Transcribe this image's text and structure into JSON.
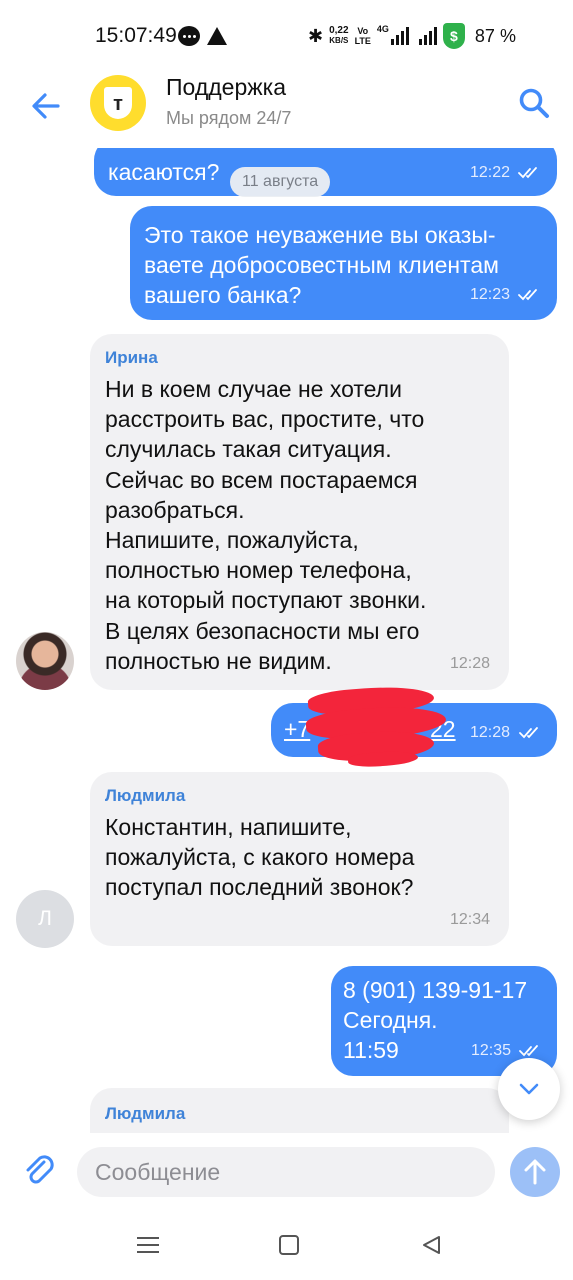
{
  "status_bar": {
    "time": "15:07:49",
    "speed_value": "0,22",
    "speed_unit": "KB/S",
    "volte_top": "Vo",
    "volte_bottom": "LTE",
    "network": "4G",
    "shield_symbol": "$",
    "battery": "87 %"
  },
  "header": {
    "title": "Поддержка",
    "subtitle": "Мы рядом 24/7",
    "logo_letter": "т",
    "accent": "#428bf9",
    "logo_color": "#ffdd2d"
  },
  "date_chip": "11 августа",
  "messages": [
    {
      "direction": "out",
      "text": "касаются?",
      "time": "12:22",
      "status": "read"
    },
    {
      "direction": "out",
      "text": "Это такое неуважение вы оказы-\nваете добросовестным клиентам\nвашего банка?",
      "time": "12:23",
      "status": "read"
    },
    {
      "direction": "in",
      "author": "Ирина",
      "text": "Ни в коем случае не хотели\nрасстроить вас, простите, что\nслучилась такая ситуация.\nСейчас во всем постараемся\nразобраться.\nНапишите, пожалуйста,\nполностью номер телефона,\nна который поступают звонки.\nВ целях безопасности мы его\nполностью не видим.",
      "time": "12:28"
    },
    {
      "direction": "out",
      "text_visible_start": "+7",
      "text_visible_end": "22",
      "redacted": true,
      "time": "12:28",
      "status": "read"
    },
    {
      "direction": "in",
      "author": "Людмила",
      "avatar_letter": "Л",
      "text": "Константин, напишите,\nпожалуйста, с какого номера\nпоступал последний звонок?",
      "time": "12:34"
    },
    {
      "direction": "out",
      "text": "8 (901) 139-91-17\nСегодня.\n11:59",
      "time": "12:35",
      "status": "read"
    },
    {
      "direction": "in",
      "author": "Людмила",
      "text": "",
      "time": ""
    }
  ],
  "composer": {
    "placeholder": "Сообщение"
  }
}
